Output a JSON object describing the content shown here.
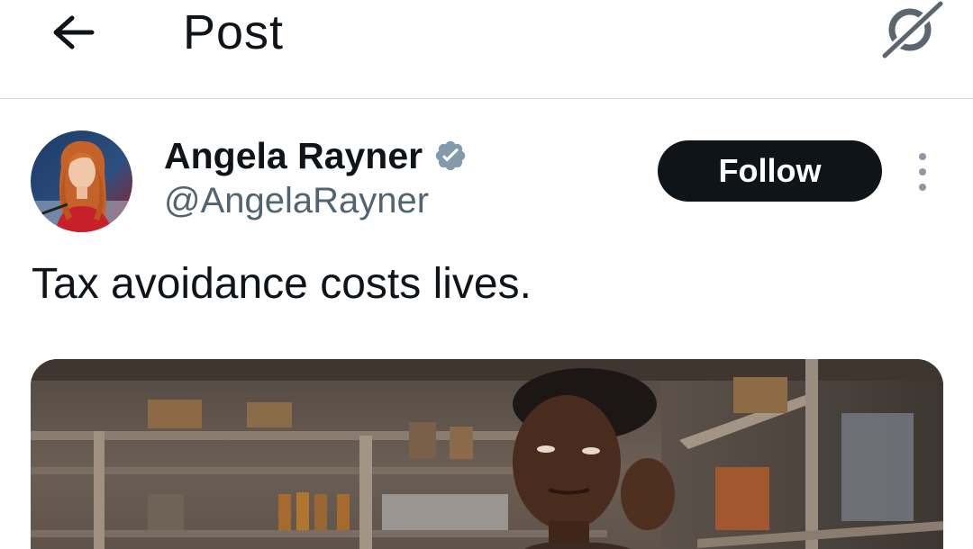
{
  "header": {
    "back_icon": "arrow-left-icon",
    "title": "Post",
    "grok_icon": "grok-icon"
  },
  "author": {
    "display_name": "Angela Rayner",
    "handle": "@AngelaRayner",
    "verified": true,
    "verified_color": "#829aab",
    "avatar_icon": "avatar-photo"
  },
  "actions": {
    "follow_label": "Follow",
    "more_icon": "more-vertical-icon"
  },
  "tweet": {
    "text": "Tax avoidance costs lives."
  },
  "media": {
    "kind": "photo"
  },
  "colors": {
    "text": "#0f1419",
    "secondary": "#536471",
    "follow_bg": "#0f1419"
  }
}
